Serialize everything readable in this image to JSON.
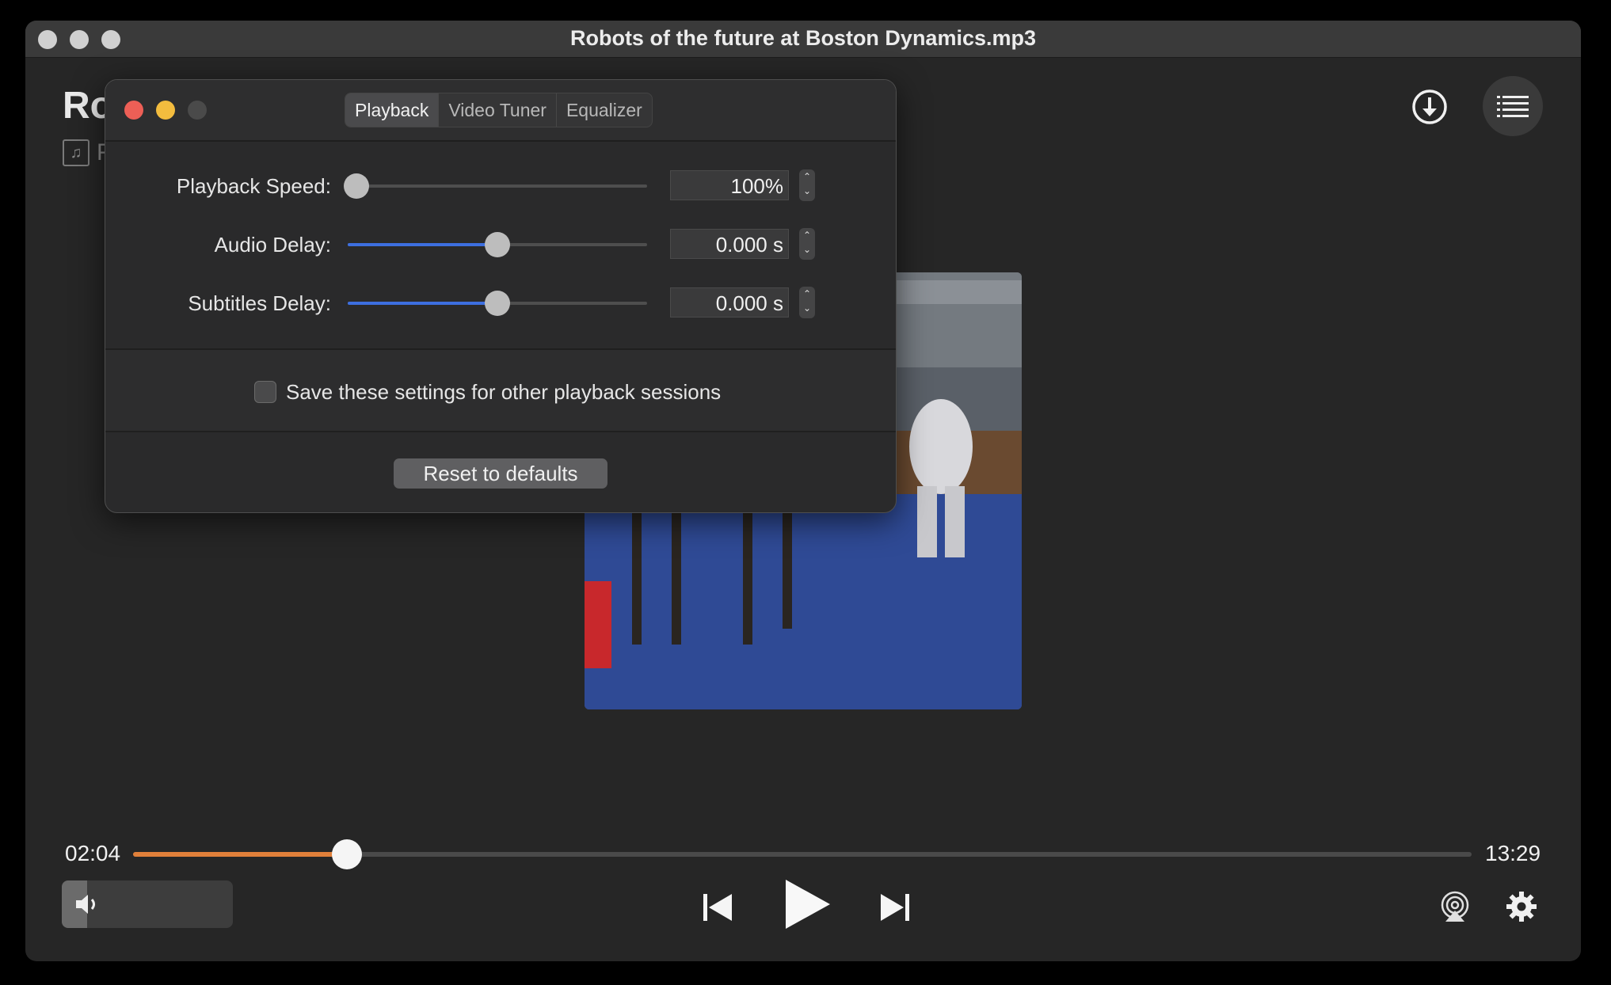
{
  "window": {
    "title": "Robots of the future at Boston Dynamics.mp3"
  },
  "track": {
    "title_visible": "Ro",
    "subtitle_visible": "F",
    "file_icon": "music-file-icon"
  },
  "header_buttons": {
    "download": "download-icon",
    "playlist": "playlist-icon"
  },
  "player": {
    "elapsed": "02:04",
    "duration": "13:29",
    "progress_fraction": 0.16,
    "volume_fraction": 0.15,
    "accent_color": "#e0803a"
  },
  "panel": {
    "tabs": [
      "Playback",
      "Video Tuner",
      "Equalizer"
    ],
    "active_tab": "Playback",
    "rows": [
      {
        "label": "Playback Speed:",
        "value": "100%",
        "slider_fraction": 0.03,
        "filled": false
      },
      {
        "label": "Audio Delay:",
        "value": "0.000 s",
        "slider_fraction": 0.5,
        "filled": true
      },
      {
        "label": "Subtitles Delay:",
        "value": "0.000 s",
        "slider_fraction": 0.5,
        "filled": true
      }
    ],
    "save_checkbox_label": "Save these settings for other playback sessions",
    "save_checked": false,
    "reset_label": "Reset to defaults",
    "slider_fill_color": "#3d6fe0"
  }
}
